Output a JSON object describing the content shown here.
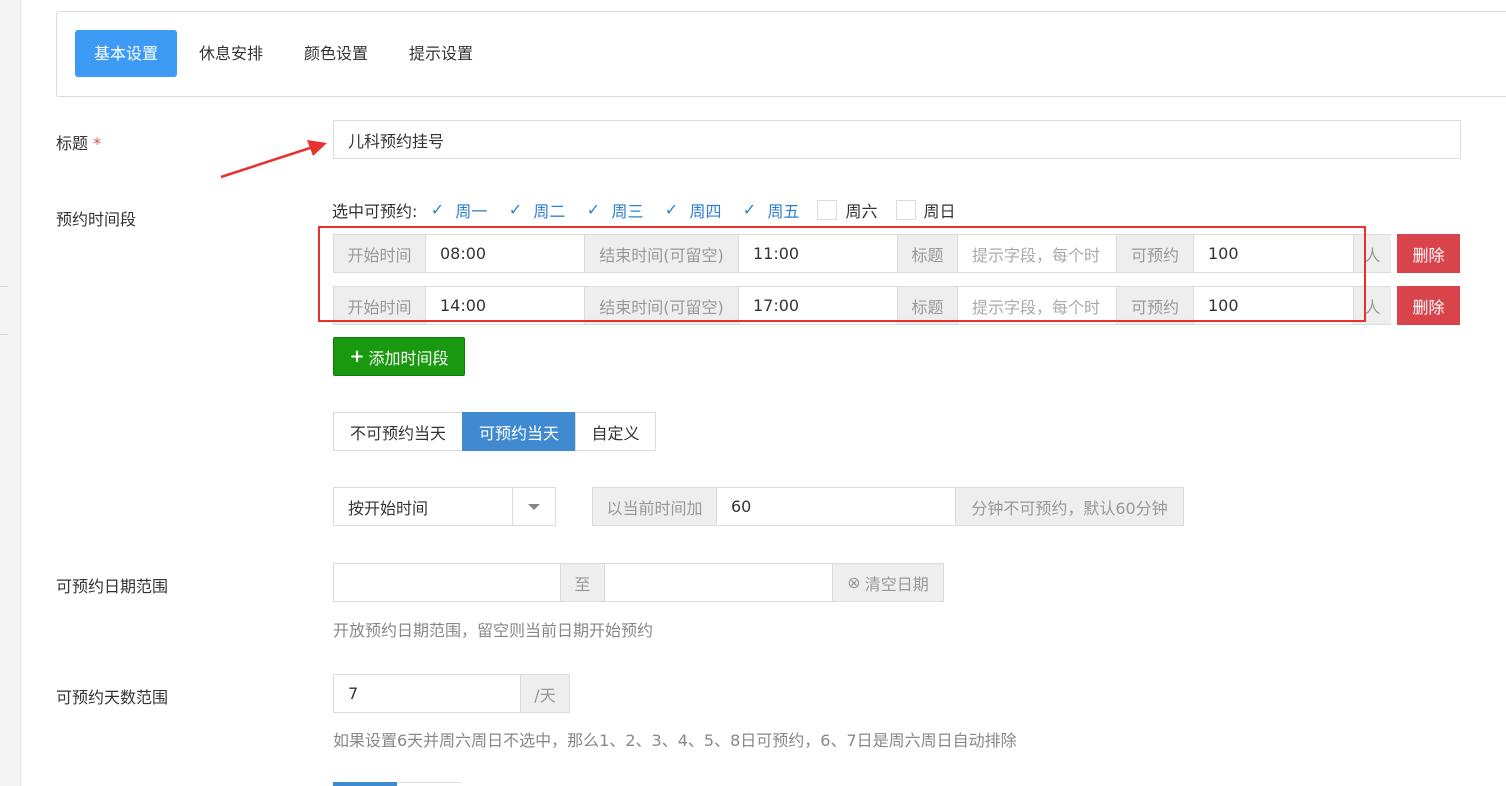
{
  "tabs": [
    {
      "label": "基本设置",
      "active": true
    },
    {
      "label": "休息安排",
      "active": false
    },
    {
      "label": "颜色设置",
      "active": false
    },
    {
      "label": "提示设置",
      "active": false
    }
  ],
  "title_field": {
    "label": "标题",
    "required_mark": "*",
    "value": "儿科预约挂号"
  },
  "time_slots": {
    "label": "预约时间段",
    "days_caption": "选中可预约:",
    "days": [
      {
        "label": "周一",
        "checked": true
      },
      {
        "label": "周二",
        "checked": true
      },
      {
        "label": "周三",
        "checked": true
      },
      {
        "label": "周四",
        "checked": true
      },
      {
        "label": "周五",
        "checked": true
      },
      {
        "label": "周六",
        "checked": false
      },
      {
        "label": "周日",
        "checked": false
      }
    ],
    "check_mark": "✓",
    "addon_start": "开始时间",
    "addon_end": "结束时间(可留空)",
    "addon_title": "标题",
    "addon_capacity": "可预约",
    "title_placeholder": "提示字段，每个时",
    "unit_person": "人",
    "delete_label": "删除",
    "rows": [
      {
        "start": "08:00",
        "end": "11:00",
        "capacity": "100"
      },
      {
        "start": "14:00",
        "end": "17:00",
        "capacity": "100"
      }
    ],
    "add_label": "添加时间段",
    "add_icon": "+"
  },
  "same_day": {
    "options": [
      "不可预约当天",
      "可预约当天",
      "自定义"
    ],
    "selected": "可预约当天"
  },
  "start_mode": {
    "selected": "按开始时间",
    "prefix": "以当前时间加",
    "value": "60",
    "suffix": "分钟不可预约，默认60分钟"
  },
  "date_range": {
    "label": "可预约日期范围",
    "separator": "至",
    "clear_label": "清空日期",
    "clear_icon": "⊗",
    "hint": "开放预约日期范围，留空则当前日期开始预约"
  },
  "day_range": {
    "label": "可预约天数范围",
    "value": "7",
    "unit": "/天",
    "hint": "如果设置6天并周六周日不选中，那么1、2、3、4、5、8日可预约，6、7日是周六周日自动排除"
  },
  "colors": {
    "primary": "#3e9bf5",
    "danger": "#d9434a",
    "success": "#18990f",
    "annotation": "#e8312f"
  }
}
